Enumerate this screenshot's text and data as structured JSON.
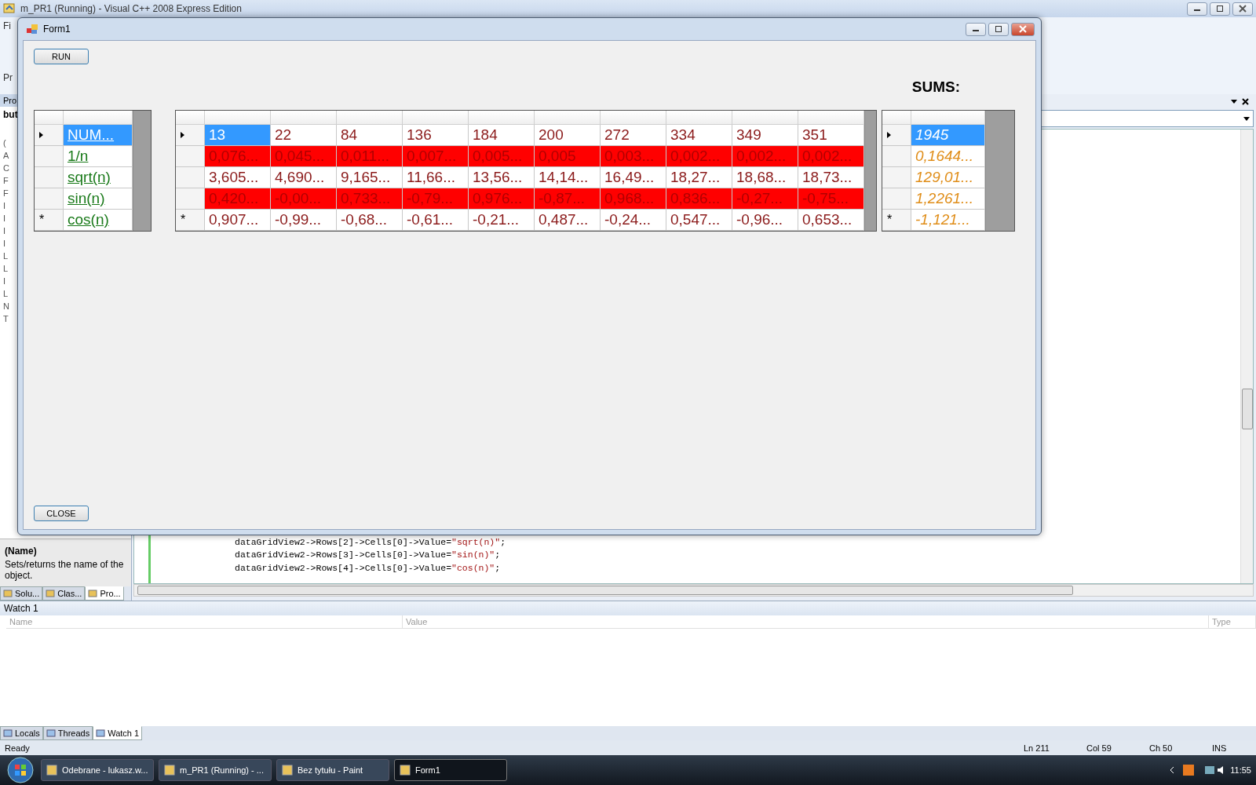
{
  "vs_window": {
    "title": "m_PR1 (Running) - Visual C++ 2008 Express Edition",
    "menu_fragment": "Fi",
    "toolbar_fragment": "Pr"
  },
  "properties_panel": {
    "tab_fragment": "Pro",
    "object_fragment": "but",
    "letters": [
      "(",
      "A",
      "C",
      "F",
      "F",
      "I",
      "I",
      "I",
      "I",
      "L",
      "L",
      "I",
      "L",
      "N",
      "T"
    ]
  },
  "description": {
    "title": "(Name)",
    "text": "Sets/returns the name of the object."
  },
  "side_tabs": [
    {
      "label": "Solu...",
      "selected": false
    },
    {
      "label": "Clas...",
      "selected": false
    },
    {
      "label": "Pro...",
      "selected": true
    }
  ],
  "code_lines": [
    {
      "code": "dataGridView2->Rows[2]->Cells[0]->Value=",
      "string": "\"sqrt(n)\"",
      "end": ";"
    },
    {
      "code": "dataGridView2->Rows[3]->Cells[0]->Value=",
      "string": "\"sin(n)\"",
      "end": ";"
    },
    {
      "code": "dataGridView2->Rows[4]->Cells[0]->Value=",
      "string": "\"cos(n)\"",
      "end": ";"
    }
  ],
  "watch": {
    "title": "Watch 1",
    "columns": [
      "Name",
      "Value",
      "Type"
    ]
  },
  "bottom_tabs": [
    {
      "label": "Locals",
      "selected": false
    },
    {
      "label": "Threads",
      "selected": false
    },
    {
      "label": "Watch 1",
      "selected": true
    }
  ],
  "status_bar": {
    "text": "Ready",
    "ln": "Ln 211",
    "col": "Col 59",
    "ch": "Ch 50",
    "mode": "INS"
  },
  "taskbar": {
    "items": [
      {
        "label": "Odebrane - lukasz.w...",
        "selected": false
      },
      {
        "label": "m_PR1 (Running) - ...",
        "selected": false
      },
      {
        "label": "Bez tytułu - Paint",
        "selected": false
      },
      {
        "label": "Form1",
        "selected": true
      }
    ],
    "clock": "11:55"
  },
  "form": {
    "title": "Form1",
    "run_button": "RUN",
    "sums_label": "SUMS:",
    "close_button": "CLOSE",
    "names_grid": {
      "rows": [
        {
          "current": true,
          "marker": "",
          "highlighted": false,
          "cells": [
            {
              "text": "NUM...",
              "selected": true
            }
          ]
        },
        {
          "current": false,
          "marker": "",
          "highlighted": false,
          "cells": [
            {
              "text": "1/n",
              "selected": false
            }
          ]
        },
        {
          "current": false,
          "marker": "",
          "highlighted": false,
          "cells": [
            {
              "text": "sqrt(n)",
              "selected": false
            }
          ]
        },
        {
          "current": false,
          "marker": "",
          "highlighted": false,
          "cells": [
            {
              "text": "sin(n)",
              "selected": false
            }
          ]
        },
        {
          "current": false,
          "marker": "*",
          "highlighted": false,
          "cells": [
            {
              "text": "cos(n)",
              "selected": false
            }
          ]
        }
      ]
    },
    "values_grid": {
      "rows": [
        {
          "current": true,
          "marker": "",
          "highlighted": false,
          "cells": [
            {
              "text": "13",
              "selected": true
            },
            {
              "text": "22",
              "selected": false
            },
            {
              "text": "84",
              "selected": false
            },
            {
              "text": "136",
              "selected": false
            },
            {
              "text": "184",
              "selected": false
            },
            {
              "text": "200",
              "selected": false
            },
            {
              "text": "272",
              "selected": false
            },
            {
              "text": "334",
              "selected": false
            },
            {
              "text": "349",
              "selected": false
            },
            {
              "text": "351",
              "selected": false
            }
          ]
        },
        {
          "current": false,
          "marker": "",
          "highlighted": true,
          "cells": [
            {
              "text": "0,076...",
              "selected": false
            },
            {
              "text": "0,045...",
              "selected": false
            },
            {
              "text": "0,011...",
              "selected": false
            },
            {
              "text": "0,007...",
              "selected": false
            },
            {
              "text": "0,005...",
              "selected": false
            },
            {
              "text": "0,005",
              "selected": false
            },
            {
              "text": "0,003...",
              "selected": false
            },
            {
              "text": "0,002...",
              "selected": false
            },
            {
              "text": "0,002...",
              "selected": false
            },
            {
              "text": "0,002...",
              "selected": false
            }
          ]
        },
        {
          "current": false,
          "marker": "",
          "highlighted": false,
          "cells": [
            {
              "text": "3,605...",
              "selected": false
            },
            {
              "text": "4,690...",
              "selected": false
            },
            {
              "text": "9,165...",
              "selected": false
            },
            {
              "text": "11,66...",
              "selected": false
            },
            {
              "text": "13,56...",
              "selected": false
            },
            {
              "text": "14,14...",
              "selected": false
            },
            {
              "text": "16,49...",
              "selected": false
            },
            {
              "text": "18,27...",
              "selected": false
            },
            {
              "text": "18,68...",
              "selected": false
            },
            {
              "text": "18,73...",
              "selected": false
            }
          ]
        },
        {
          "current": false,
          "marker": "",
          "highlighted": true,
          "cells": [
            {
              "text": "0,420...",
              "selected": false
            },
            {
              "text": "-0,00...",
              "selected": false
            },
            {
              "text": "0,733...",
              "selected": false
            },
            {
              "text": "-0,79...",
              "selected": false
            },
            {
              "text": "0,976...",
              "selected": false
            },
            {
              "text": "-0,87...",
              "selected": false
            },
            {
              "text": "0,968...",
              "selected": false
            },
            {
              "text": "0,836...",
              "selected": false
            },
            {
              "text": "-0,27...",
              "selected": false
            },
            {
              "text": "-0,75...",
              "selected": false
            }
          ]
        },
        {
          "current": false,
          "marker": "*",
          "highlighted": false,
          "cells": [
            {
              "text": "0,907...",
              "selected": false
            },
            {
              "text": "-0,99...",
              "selected": false
            },
            {
              "text": "-0,68...",
              "selected": false
            },
            {
              "text": "-0,61...",
              "selected": false
            },
            {
              "text": "-0,21...",
              "selected": false
            },
            {
              "text": "0,487...",
              "selected": false
            },
            {
              "text": "-0,24...",
              "selected": false
            },
            {
              "text": "0,547...",
              "selected": false
            },
            {
              "text": "-0,96...",
              "selected": false
            },
            {
              "text": "0,653...",
              "selected": false
            }
          ]
        }
      ]
    },
    "sums_grid": {
      "rows": [
        {
          "current": true,
          "marker": "",
          "highlighted": false,
          "cells": [
            {
              "text": "1945",
              "selected": true
            }
          ]
        },
        {
          "current": false,
          "marker": "",
          "highlighted": false,
          "cells": [
            {
              "text": "0,1644...",
              "selected": false
            }
          ]
        },
        {
          "current": false,
          "marker": "",
          "highlighted": false,
          "cells": [
            {
              "text": "129,01...",
              "selected": false
            }
          ]
        },
        {
          "current": false,
          "marker": "",
          "highlighted": false,
          "cells": [
            {
              "text": "1,2261...",
              "selected": false
            }
          ]
        },
        {
          "current": false,
          "marker": "*",
          "highlighted": false,
          "cells": [
            {
              "text": "-1,121...",
              "selected": false
            }
          ]
        }
      ]
    }
  }
}
